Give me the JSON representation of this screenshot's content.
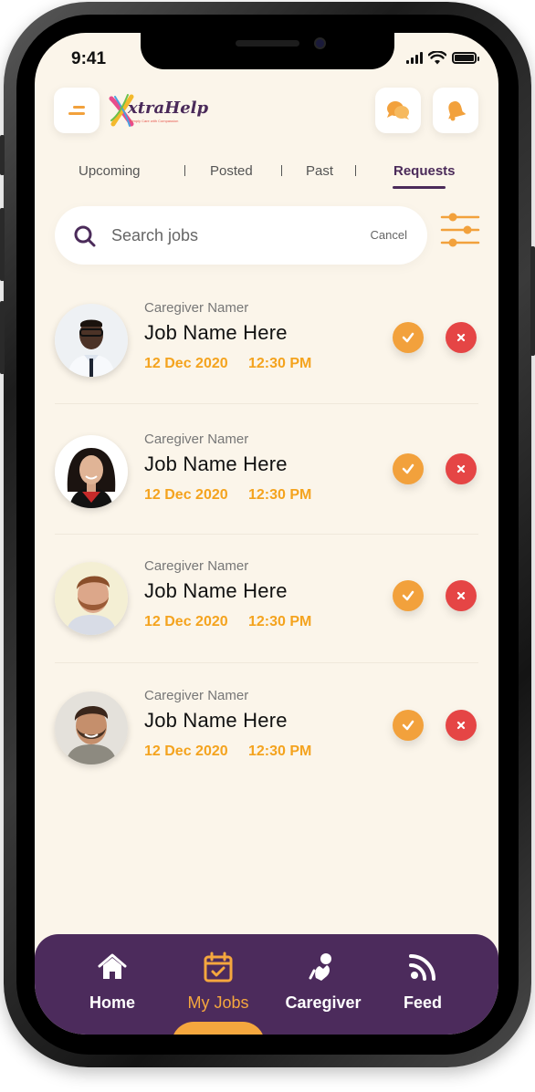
{
  "status_bar": {
    "time": "9:41"
  },
  "header": {
    "logo_text": "xtraHelp",
    "logo_tagline": "Simply Care with Compassion"
  },
  "tabs": [
    {
      "label": "Upcoming",
      "active": false
    },
    {
      "label": "Posted",
      "active": false
    },
    {
      "label": "Past",
      "active": false
    },
    {
      "label": "Requests",
      "active": true
    }
  ],
  "search": {
    "placeholder": "Search jobs",
    "value": "",
    "cancel_label": "Cancel"
  },
  "jobs": [
    {
      "caregiver": "Caregiver Namer",
      "title": "Job Name Here",
      "date": "12 Dec 2020",
      "time": "12:30 PM"
    },
    {
      "caregiver": "Caregiver Namer",
      "title": "Job Name Here",
      "date": "12 Dec 2020",
      "time": "12:30 PM"
    },
    {
      "caregiver": "Caregiver Namer",
      "title": "Job Name Here",
      "date": "12 Dec 2020",
      "time": "12:30 PM"
    },
    {
      "caregiver": "Caregiver Namer",
      "title": "Job Name Here",
      "date": "12 Dec 2020",
      "time": "12:30 PM"
    }
  ],
  "bottom_nav": [
    {
      "label": "Home",
      "icon": "home-icon",
      "active": false
    },
    {
      "label": "My Jobs",
      "icon": "calendar-check-icon",
      "active": true
    },
    {
      "label": "Caregiver",
      "icon": "caregiver-hand-icon",
      "active": false
    },
    {
      "label": "Feed",
      "icon": "rss-feed-icon",
      "active": false
    }
  ],
  "colors": {
    "background": "#fbf5ea",
    "accent_orange": "#f2a13c",
    "reject_red": "#e54545",
    "brand_purple": "#4c2b5c",
    "date_orange": "#f4a31e"
  }
}
